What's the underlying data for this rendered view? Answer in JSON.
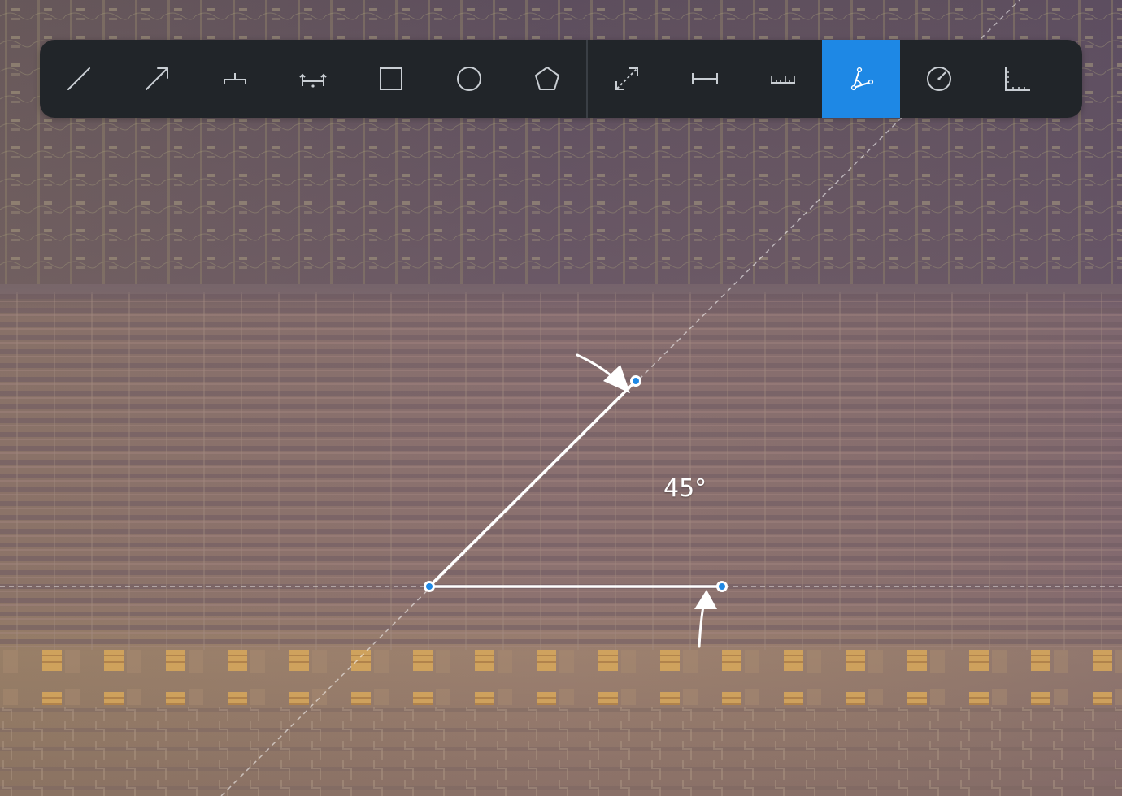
{
  "toolbar": {
    "tools": [
      {
        "id": "line",
        "icon": "line-icon",
        "active": false
      },
      {
        "id": "arrow",
        "icon": "arrow-icon",
        "active": false
      },
      {
        "id": "baseline-mark",
        "icon": "baseline-mark-icon",
        "active": false
      },
      {
        "id": "span-mark",
        "icon": "span-mark-icon",
        "active": false
      },
      {
        "id": "rectangle",
        "icon": "rectangle-icon",
        "active": false
      },
      {
        "id": "circle",
        "icon": "circle-icon",
        "active": false
      },
      {
        "id": "polygon",
        "icon": "polygon-icon",
        "active": false
      },
      {
        "id": "distance",
        "icon": "distance-icon",
        "active": false
      },
      {
        "id": "width",
        "icon": "width-icon",
        "active": false
      },
      {
        "id": "ruler",
        "icon": "ruler-icon",
        "active": false
      },
      {
        "id": "angle",
        "icon": "angle-icon",
        "active": true
      },
      {
        "id": "radius",
        "icon": "radius-icon",
        "active": false
      },
      {
        "id": "scale",
        "icon": "scale-icon",
        "active": false
      }
    ],
    "active_color": "#1e88e5",
    "background_color": "#212529"
  },
  "measurement": {
    "type": "angle",
    "value_label": "45°",
    "line_color": "#ffffff",
    "handle_color": "#1e88e5"
  }
}
